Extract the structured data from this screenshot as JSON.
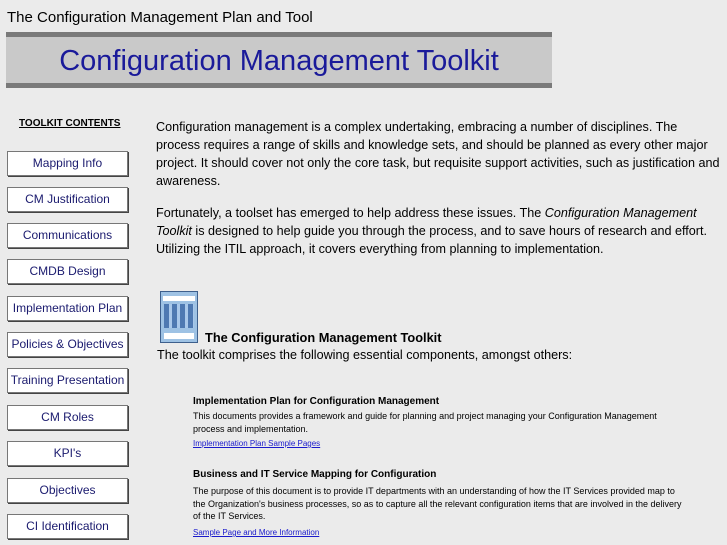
{
  "page": {
    "top_title": "The Configuration Management Plan and Tool"
  },
  "banner": {
    "title": "Configuration Management Toolkit"
  },
  "sidebar": {
    "heading": "TOOLKIT CONTENTS",
    "items": [
      {
        "label": "Mapping Info"
      },
      {
        "label": "CM Justification"
      },
      {
        "label": "Communications"
      },
      {
        "label": "CMDB Design"
      },
      {
        "label": "Implementation Plan"
      },
      {
        "label": "Policies & Objectives"
      },
      {
        "label": "Training Presentation"
      },
      {
        "label": "CM Roles"
      },
      {
        "label": "KPI's"
      },
      {
        "label": "Objectives"
      },
      {
        "label": "CI Identification"
      }
    ]
  },
  "main": {
    "intro_paragraph": "Configuration management is a complex undertaking, embracing a number of disciplines. The process requires a range of skills and knowledge sets, and should be planned as every other major project. It should cover not only the core task, but requisite support activities, such as justification and awareness.",
    "second_paragraph": {
      "before": "Fortunately, a toolset has emerged to help address these issues. The ",
      "emphasis": "Configuration Management Toolkit",
      "after": " is designed to help guide you through the process, and to save hours of research and effort.  Utilizing the ITIL approach, it covers everything from planning to implementation."
    },
    "toolkit_title": "The Configuration Management Toolkit",
    "toolkit_intro": "The toolkit comprises the following essential components, amongst others:",
    "components": [
      {
        "title": "Implementation Plan for Configuration Management",
        "description": "This documents provides a framework and guide for planning and project managing your Configuration Management process and implementation.",
        "link": "Implementation Plan Sample Pages"
      },
      {
        "title": "Business and IT Service Mapping for Configuration",
        "description": "The purpose of this document is to provide IT departments with an understanding of how the IT Services provided map to the Organization's business processes, so as to capture all the relevant configuration items that are involved in the delivery of the IT Services.",
        "link": "Sample Page  and More Information"
      }
    ]
  }
}
